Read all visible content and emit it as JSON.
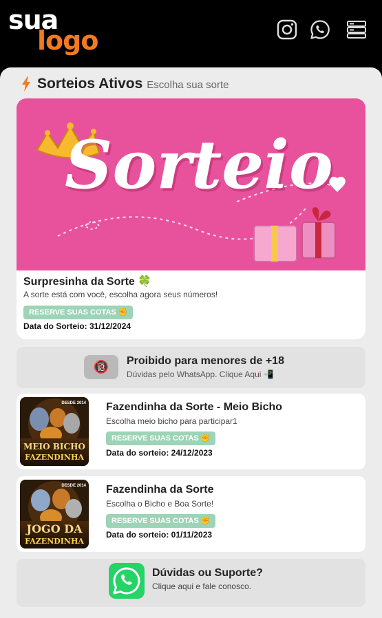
{
  "logo": {
    "line1": "sua",
    "line2": "logo"
  },
  "header_icons": [
    "instagram-icon",
    "whatsapp-icon",
    "menu-icon"
  ],
  "section": {
    "title": "Sorteios Ativos",
    "subtitle": "Escolha sua sorte"
  },
  "featured": {
    "banner_text": "Sorteio",
    "title": "Surpresinha da Sorte 🍀",
    "description": "A sorte está com você, escolha agora seus números!",
    "badge": "RESERVE SUAS COTAS ✊",
    "date": "Data do Sorteio: 31/12/2024"
  },
  "notice": {
    "icon": "🔞",
    "title": "Proibido para menores de +18",
    "subtitle": "Dúvidas pelo WhatsApp. Clique Aqui 📲"
  },
  "items": [
    {
      "thumb_line1": "MEIO BICHO",
      "thumb_line2": "FAZENDINHA",
      "thumb_tag": "DESDE 2014",
      "title": "Fazendinha da Sorte - Meio Bicho",
      "description": "Escolha meio bicho para participar1",
      "badge": "RESERVE SUAS COTAS ✊",
      "date": "Data do sorteio: 24/12/2023"
    },
    {
      "thumb_line1": "JOGO DA",
      "thumb_line2": "FAZENDINHA",
      "thumb_tag": "DESDE 2014",
      "title": "Fazendinha da Sorte",
      "description": "Escolha o Bicho e Boa Sorte!",
      "badge": "RESERVE SUAS COTAS ✊",
      "date": "Data do sorteio: 01/11/2023"
    }
  ],
  "support": {
    "title": "Dúvidas ou Suporte?",
    "subtitle": "Clique aqui e fale conosco."
  },
  "colors": {
    "accent": "#f47a20",
    "banner": "#e8529c",
    "badge": "#9dd3b6",
    "whatsapp": "#25d366"
  }
}
